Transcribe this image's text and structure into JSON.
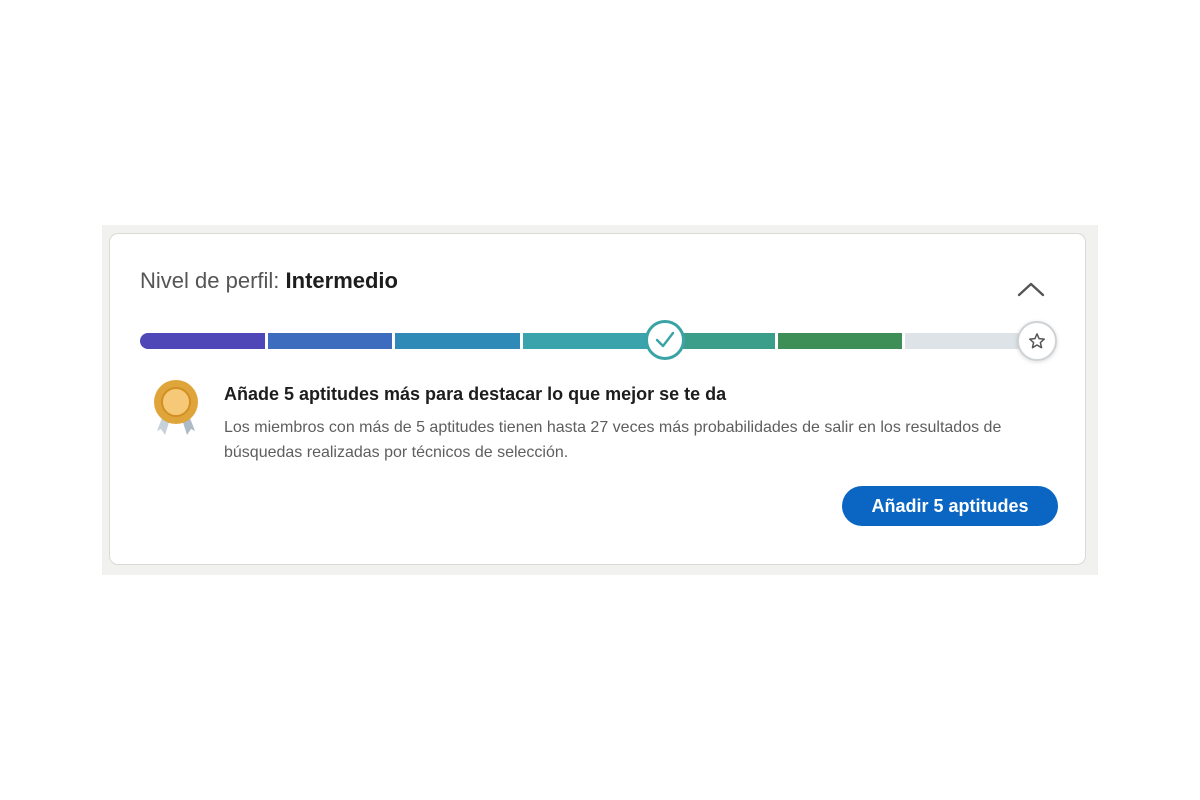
{
  "profile": {
    "label": "Nivel de perfil: ",
    "level": "Intermedio"
  },
  "progress": {
    "segments_total": 7,
    "completed_checkpoint": 4,
    "segment_colors": [
      "#4f46b8",
      "#3d6cbf",
      "#2f8ab8",
      "#3aa3ac",
      "#3a9e8a",
      "#3d8f57",
      "#dde3e7"
    ],
    "accent": "#3aa3a6"
  },
  "suggestion": {
    "heading": "Añade 5 aptitudes más para destacar lo que mejor se te da",
    "description": "Los miembros con más de 5 aptitudes tienen hasta 27 veces más probabilidades de salir en los resultados de búsquedas realizadas por técnicos de selección.",
    "button_label": "Añadir 5 aptitudes",
    "button_color": "#0a66c2"
  },
  "icons": {
    "collapse": "chevron-up-icon",
    "checkpoint": "checkmark-icon",
    "goal": "star-icon",
    "badge": "medal-icon"
  }
}
